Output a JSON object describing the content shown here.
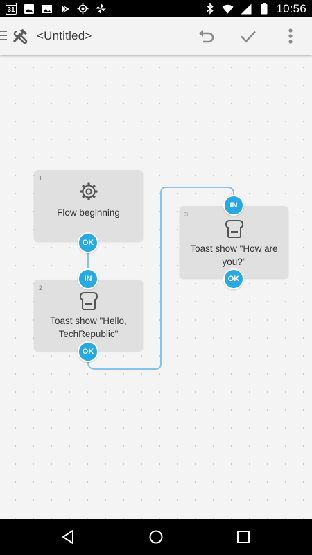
{
  "status_bar": {
    "calendar_day": "31",
    "time": "10:56",
    "left_icons": [
      "calendar-icon",
      "image-icon",
      "gallery-icon",
      "play-store-icon",
      "gps-icon",
      "pinwheel-icon"
    ],
    "right_icons": [
      "bluetooth-icon",
      "wifi-icon",
      "signal-icon",
      "battery-icon"
    ]
  },
  "toolbar": {
    "title": "<Untitled>",
    "icons": [
      "drawer-handle-icon",
      "tools-icon",
      "undo-icon",
      "check-icon",
      "more-vert-icon"
    ]
  },
  "flow": {
    "blocks": [
      {
        "number": "1",
        "icon": "gear-icon",
        "label": "Flow beginning",
        "out_port": "OK"
      },
      {
        "number": "2",
        "icon": "toast-icon",
        "label": "Toast show \"Hello, TechRepublic\"",
        "in_port": "IN",
        "out_port": "OK"
      },
      {
        "number": "3",
        "icon": "toast-icon",
        "label": "Toast show \"How are you?\"",
        "in_port": "IN",
        "out_port": "OK"
      }
    ],
    "connector_color": "#85c4e6",
    "port_color": "#29a9e1"
  },
  "nav_bar": {
    "icons": [
      "back-icon",
      "home-icon",
      "recents-icon"
    ]
  }
}
